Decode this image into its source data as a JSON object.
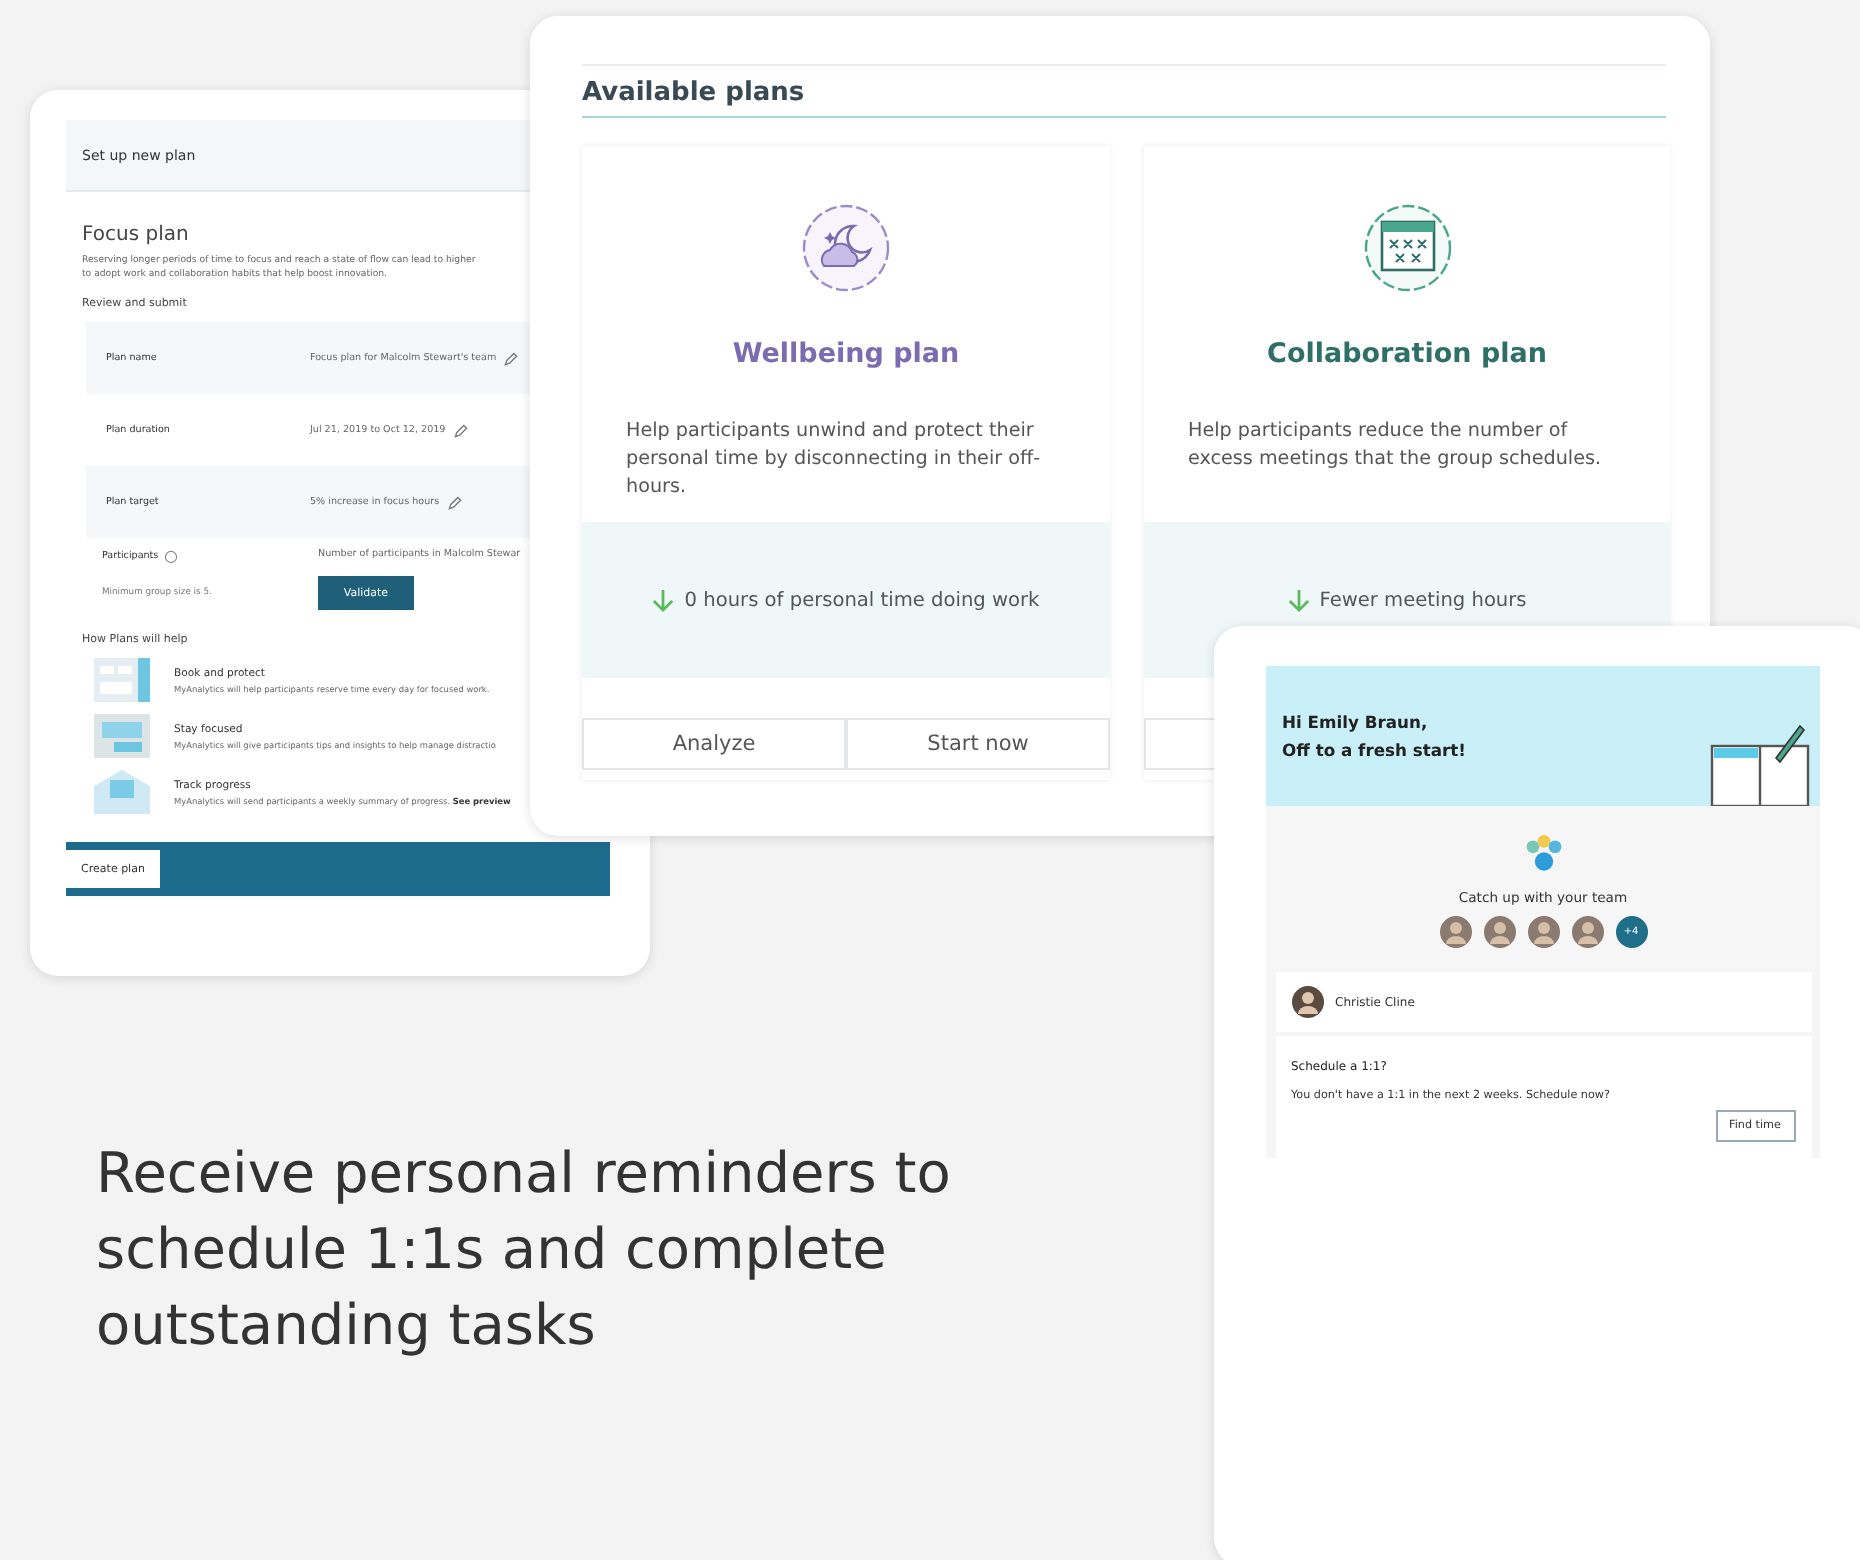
{
  "setup_window": {
    "header": "Set up new plan",
    "title": "Focus plan",
    "description": "Reserving longer periods of time to focus and reach a state of flow can lead to higher\nto adopt work and collaboration habits that help boost innovation.",
    "section": "Review and submit",
    "rows": [
      {
        "label": "Plan name",
        "value": "Focus plan for Malcolm Stewart's team",
        "editable": true
      },
      {
        "label": "Plan duration",
        "value": "Jul 21, 2019 to Oct 12, 2019",
        "editable": true
      },
      {
        "label": "Plan target",
        "value": "5% increase in focus hours",
        "editable": true
      }
    ],
    "participants": {
      "label": "Participants",
      "value": "Number of participants in Malcolm Stewar",
      "hint": "Minimum group size is 5.",
      "button": "Validate"
    },
    "help_title": "How Plans will help",
    "help_items": [
      {
        "kind": "calendar",
        "title": "Book and protect",
        "text": "MyAnalytics will help participants reserve time every day for focused work."
      },
      {
        "kind": "screen",
        "title": "Stay focused",
        "text": "MyAnalytics will give participants tips and insights to help manage distractio"
      },
      {
        "kind": "mail",
        "title": "Track progress",
        "text": "MyAnalytics will send participants a weekly summary of progress.",
        "link": "See preview"
      }
    ],
    "create_button": "Create plan"
  },
  "plans_window": {
    "title": "Available plans",
    "plans": [
      {
        "kind": "wellbeing",
        "name": "Wellbeing plan",
        "color": "#7b6bb0",
        "description": "Help participants unwind and protect their personal time by disconnecting in their off-hours.",
        "outcome": "0 hours of personal time doing work",
        "buttons": [
          "Analyze",
          "Start now"
        ]
      },
      {
        "kind": "collaboration",
        "name": "Collaboration plan",
        "color": "#2e6f66",
        "description": "Help participants reduce the number of excess meetings that the group schedules.",
        "outcome": "Fewer meeting hours"
      }
    ]
  },
  "reminder_window": {
    "greeting": "Hi Emily Braun,\nOff to a fresh start!",
    "team_title": "Catch up with your team",
    "more_count": "+4",
    "contact": "Christie Cline",
    "prompt_title": "Schedule a 1:1?",
    "prompt_text": "You don't have a 1:1 in the next 2 weeks. Schedule now?",
    "prompt_button": "Find time"
  },
  "caption": "Receive personal reminders to schedule 1:1s and complete outstanding tasks"
}
